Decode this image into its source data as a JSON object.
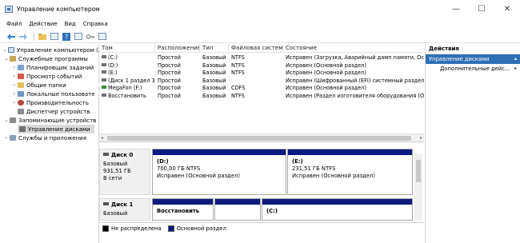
{
  "window": {
    "title": "Управление компьютером",
    "minimize_glyph": "—",
    "maximize_glyph": "☐",
    "close_glyph": "✕"
  },
  "menu": [
    "Файл",
    "Действие",
    "Вид",
    "Справка"
  ],
  "toolbar_icons": [
    "back-arrow-icon",
    "forward-arrow-icon",
    "folder-up-icon",
    "show-tree-icon",
    "help-icon",
    "properties-icon",
    "key-icon",
    "console-icon"
  ],
  "tree": {
    "root": "Управление компьютером (лс",
    "utilities": "Служебные программы",
    "scheduler": "Планировщик заданий",
    "events": "Просмотр событий",
    "shared": "Общие папки",
    "users": "Локальные пользовате",
    "perf": "Производительность",
    "devmgr": "Диспетчер устройств",
    "storage": "Запоминающие устройств",
    "diskmgmt": "Управление дисками",
    "services": "Службы и приложения"
  },
  "volumes": {
    "headers": [
      "Том",
      "Расположение",
      "Тип",
      "Файловая система",
      "Состояние"
    ],
    "rows": [
      [
        "(C:)",
        "Простой",
        "Базовый",
        "NTFS",
        "Исправен (Загрузка, Аварийный дамп памяти, Осно"
      ],
      [
        "(D:)",
        "Простой",
        "Базовый",
        "NTFS",
        "Исправен (Основной раздел)"
      ],
      [
        "(E:)",
        "Простой",
        "Базовый",
        "NTFS",
        "Исправен (Основной раздел)"
      ],
      [
        "(Диск 1 раздел 3)",
        "Простой",
        "Базовый",
        "",
        "Исправен (Шифрованный (EFI) системный раздел)"
      ],
      [
        "MegaFon (F:)",
        "Простой",
        "Базовый",
        "CDFS",
        "Исправен (Основной раздел)"
      ],
      [
        "Восстановить",
        "Простой",
        "Базовый",
        "NTFS",
        "Исправен (Раздел изготовителя оборудования (OEM"
      ]
    ]
  },
  "disks": [
    {
      "name": "Диск 0",
      "type": "Базовый",
      "size": "931,51 ГБ",
      "status": "В сети",
      "partitions": [
        {
          "name": "(D:)",
          "size": "700,00 ГБ NTFS",
          "status": "Исправен (Основной раздел)"
        },
        {
          "name": "(E:)",
          "size": "231,51 ГБ NTFS",
          "status": "Исправен (Основной раздел)"
        }
      ]
    },
    {
      "name": "Диск 1",
      "type": "Базовый",
      "size": "",
      "partitions": [
        {
          "name": "Восстановить",
          "size": "",
          "status": ""
        },
        {
          "name": "",
          "size": "",
          "status": ""
        },
        {
          "name": "(C:)",
          "size": "",
          "status": ""
        }
      ]
    }
  ],
  "legend": {
    "unallocated": "Не распределена",
    "primary": "Основной раздел",
    "unallocated_color": "#000000",
    "primary_color": "#0d1a7e"
  },
  "actions": {
    "header": "Действия",
    "section": "Управление дисками",
    "more": "Дополнительные дейс...",
    "accent": "#2f6fb5"
  }
}
